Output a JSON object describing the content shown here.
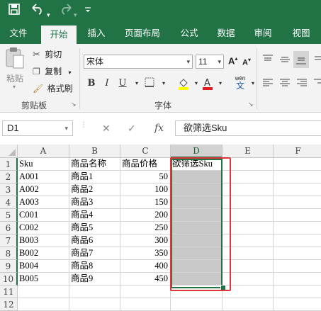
{
  "quick_access": {
    "save_icon": "save-icon",
    "undo_icon": "undo-icon",
    "redo_icon": "redo-icon",
    "customize_icon": "customize-icon"
  },
  "tabs": [
    "文件",
    "开始",
    "插入",
    "页面布局",
    "公式",
    "数据",
    "审阅",
    "视图"
  ],
  "ribbon": {
    "clipboard": {
      "paste": "粘贴",
      "cut": "剪切",
      "copy": "复制",
      "format_painter": "格式刷",
      "group": "剪贴板"
    },
    "font": {
      "name": "宋体",
      "size": "11",
      "group": "字体",
      "bold": "B",
      "italic": "I",
      "underline": "U",
      "wen": "wén",
      "wen_char": "文"
    }
  },
  "formula_bar": {
    "name_box": "D1",
    "cancel": "✕",
    "enter": "✓",
    "fx": "fx",
    "content": "欲筛选Sku"
  },
  "columns": [
    "A",
    "B",
    "C",
    "D",
    "E",
    "F"
  ],
  "rows": [
    {
      "n": "1",
      "a": "Sku",
      "b": "商品名称",
      "c": "商品价格",
      "d": "欲筛选Sku"
    },
    {
      "n": "2",
      "a": "A001",
      "b": "商品1",
      "c": "50",
      "d": ""
    },
    {
      "n": "3",
      "a": "A002",
      "b": "商品2",
      "c": "100",
      "d": ""
    },
    {
      "n": "4",
      "a": "A003",
      "b": "商品3",
      "c": "150",
      "d": ""
    },
    {
      "n": "5",
      "a": "C001",
      "b": "商品4",
      "c": "200",
      "d": ""
    },
    {
      "n": "6",
      "a": "C002",
      "b": "商品5",
      "c": "250",
      "d": ""
    },
    {
      "n": "7",
      "a": "B003",
      "b": "商品6",
      "c": "300",
      "d": ""
    },
    {
      "n": "8",
      "a": "B002",
      "b": "商品7",
      "c": "350",
      "d": ""
    },
    {
      "n": "9",
      "a": "B004",
      "b": "商品8",
      "c": "400",
      "d": ""
    },
    {
      "n": "10",
      "a": "B005",
      "b": "商品9",
      "c": "450",
      "d": ""
    },
    {
      "n": "11",
      "a": "",
      "b": "",
      "c": "",
      "d": ""
    },
    {
      "n": "12",
      "a": "",
      "b": "",
      "c": "",
      "d": ""
    }
  ],
  "colors": {
    "accent": "#217346",
    "highlight": "#c8c8c8",
    "annotation": "#e0363b"
  }
}
